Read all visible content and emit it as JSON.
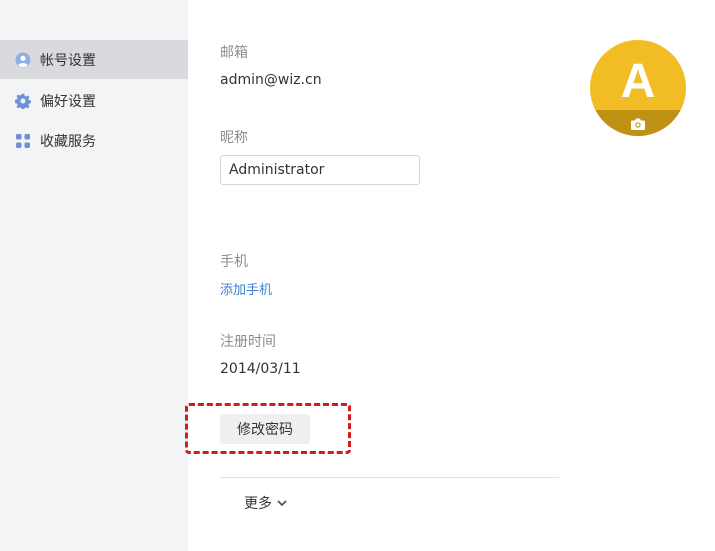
{
  "sidebar": {
    "items": [
      {
        "label": "帐号设置",
        "icon": "user-icon",
        "active": true
      },
      {
        "label": "偏好设置",
        "icon": "gear-icon",
        "active": false
      },
      {
        "label": "收藏服务",
        "icon": "apps-icon",
        "active": false
      }
    ]
  },
  "account": {
    "email_label": "邮箱",
    "email_value": "admin@wiz.cn",
    "nickname_label": "昵称",
    "nickname_value": "Administrator",
    "phone_label": "手机",
    "phone_link": "添加手机",
    "register_label": "注册时间",
    "register_value": "2014/03/11",
    "change_password_label": "修改密码",
    "more_label": "更多"
  },
  "avatar": {
    "letter": "A",
    "background": "#f2bd24",
    "camera_icon": "camera-icon"
  },
  "colors": {
    "link": "#3b82d6",
    "highlight": "#d01c1c",
    "sidebar_bg": "#f3f4f6",
    "sidebar_active": "#d9dadd"
  }
}
